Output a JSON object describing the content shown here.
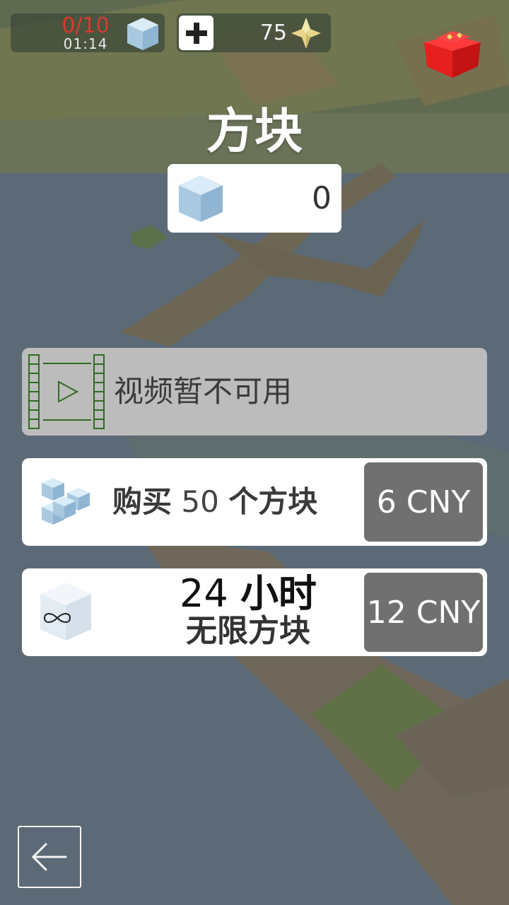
{
  "hud": {
    "blocks_progress": "0/10",
    "timer": "01:14",
    "plus_label": "+",
    "gems": "75"
  },
  "title": "方块",
  "counter": {
    "value": "0"
  },
  "offers": {
    "video": {
      "label": "视频暂不可用"
    },
    "buy": {
      "label_pre": "购买",
      "amount": "50",
      "label_post": "个方块",
      "price": "6 CNY"
    },
    "unlimited": {
      "hours": "24",
      "hours_unit": "小时",
      "label": "无限方块",
      "price": "12 CNY"
    }
  },
  "colors": {
    "accent_red": "#d83a2e",
    "price_button": "#707070",
    "disabled_panel": "#bcbcbc",
    "gem": "#e8d58a"
  },
  "icons": [
    "cube-icon",
    "plus-icon",
    "gem-icon",
    "gift-icon",
    "film-play-icon",
    "cubes-icon",
    "infinity-cube-icon",
    "back-arrow-icon"
  ]
}
